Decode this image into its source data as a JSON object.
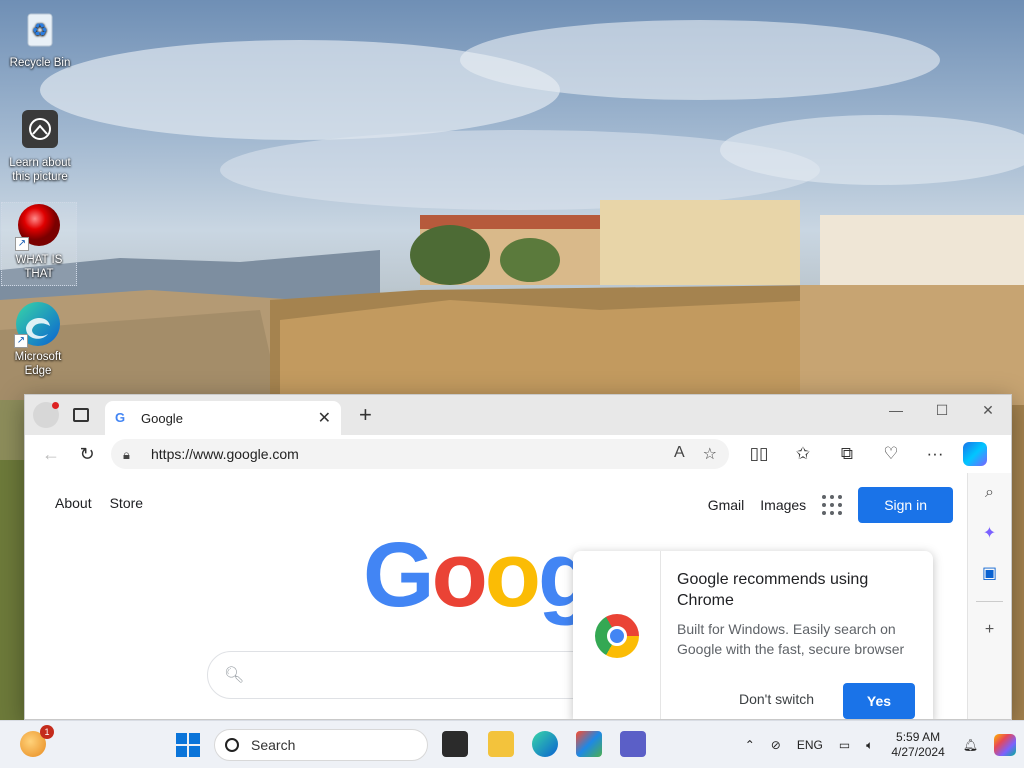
{
  "desktop": {
    "icons": [
      {
        "label": "Recycle Bin"
      },
      {
        "label": "Learn about this picture"
      },
      {
        "label": "WHAT IS THAT"
      },
      {
        "label": "Microsoft Edge"
      }
    ]
  },
  "browser": {
    "tab": {
      "title": "Google"
    },
    "address": {
      "url": "https://www.google.com"
    },
    "window_controls": {
      "minimize": "—",
      "maximize": "☐",
      "close": "✕"
    }
  },
  "google": {
    "top_left": [
      "About",
      "Store"
    ],
    "top_right": {
      "gmail": "Gmail",
      "images": "Images",
      "signin": "Sign in"
    },
    "logo_letters": [
      "G",
      "o",
      "o",
      "g"
    ],
    "search_placeholder": ""
  },
  "popup": {
    "title": "Google recommends using Chrome",
    "body": "Built for Windows. Easily search on Google with the fast, secure browser",
    "dont_switch": "Don't switch",
    "yes": "Yes"
  },
  "taskbar": {
    "widget_badge": "1",
    "search_label": "Search",
    "language": "ENG",
    "time": "5:59 AM",
    "date": "4/27/2024"
  }
}
